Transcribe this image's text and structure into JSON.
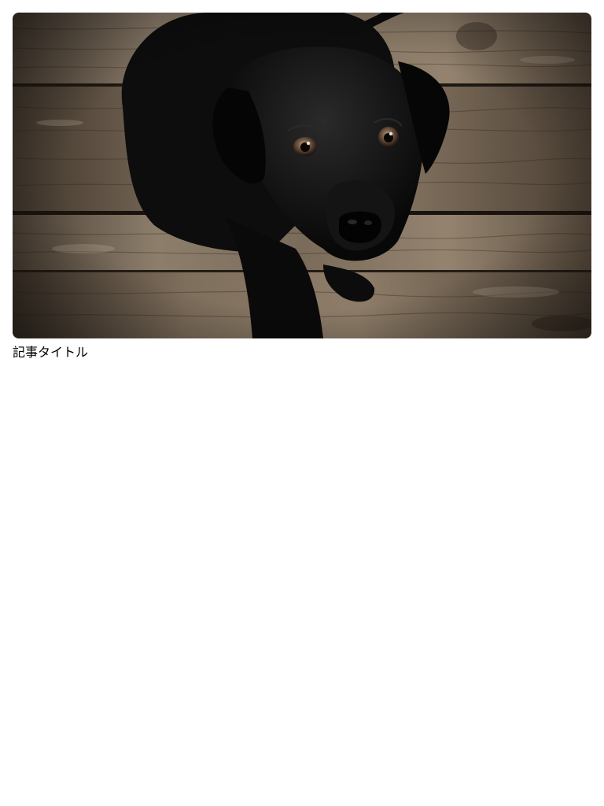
{
  "article": {
    "title": "記事タイトル",
    "image": {
      "subject": "black-puppy-photo"
    }
  },
  "colors": {
    "background": "#ffffff",
    "text": "#000000",
    "wood_light": "#8a7a66",
    "wood_dark": "#3d342b",
    "dog": "#0c0c0c"
  }
}
